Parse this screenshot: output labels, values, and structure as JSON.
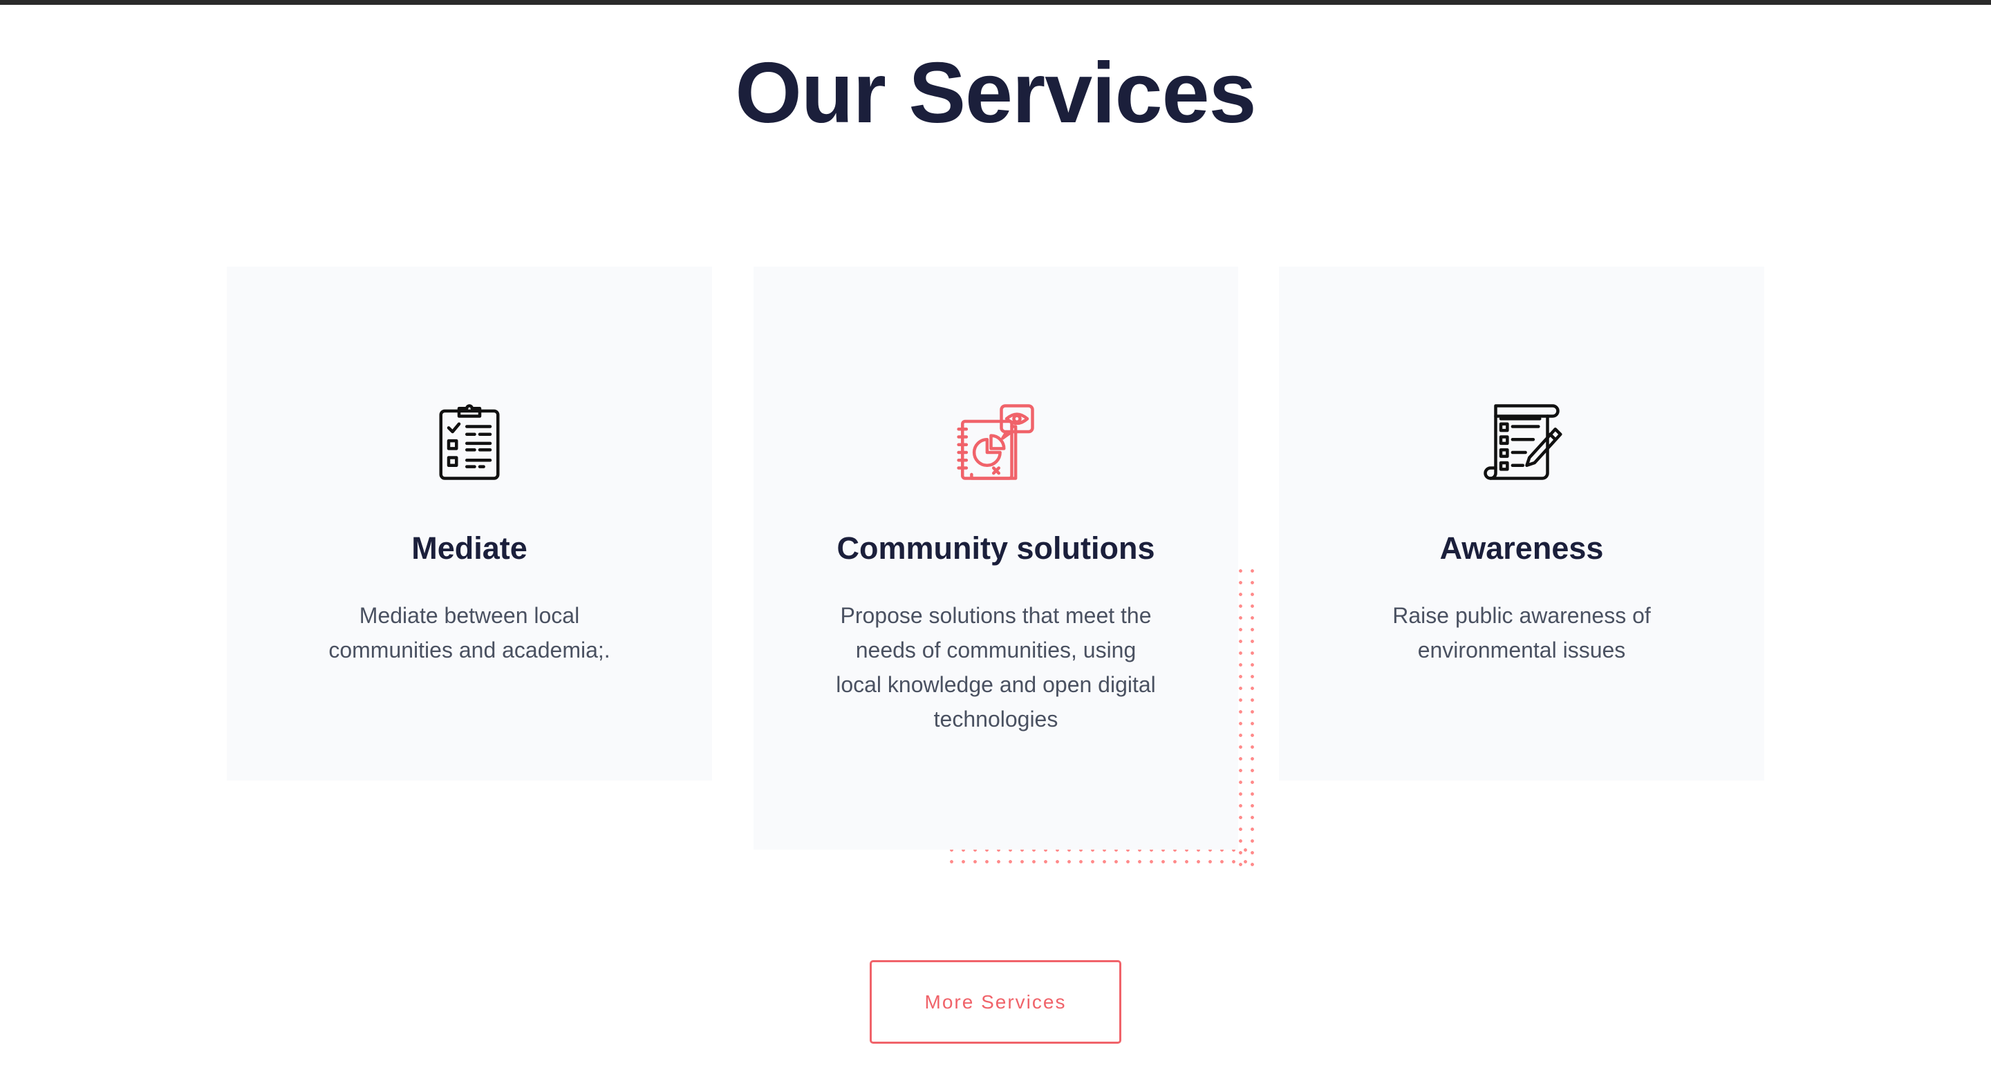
{
  "section": {
    "title": "Our Services"
  },
  "services": [
    {
      "icon": "clipboard-checklist-icon",
      "title": "Mediate",
      "description": "Mediate between local communities and academia;.",
      "icon_color": "#111111"
    },
    {
      "icon": "notebook-eye-icon",
      "title": "Community solutions",
      "description": "Propose solutions that meet the needs of communities, using local knowledge and open digital technologies",
      "icon_color": "#f0636a"
    },
    {
      "icon": "document-pen-icon",
      "title": "Awareness",
      "description": "Raise public awareness of environmental issues",
      "icon_color": "#111111"
    }
  ],
  "cta": {
    "label": "More Services"
  },
  "colors": {
    "heading": "#1b1f3b",
    "body_text": "#4a5161",
    "accent": "#f0636a",
    "card_bg": "#f9fafc",
    "dots": "#ff8a8a"
  }
}
